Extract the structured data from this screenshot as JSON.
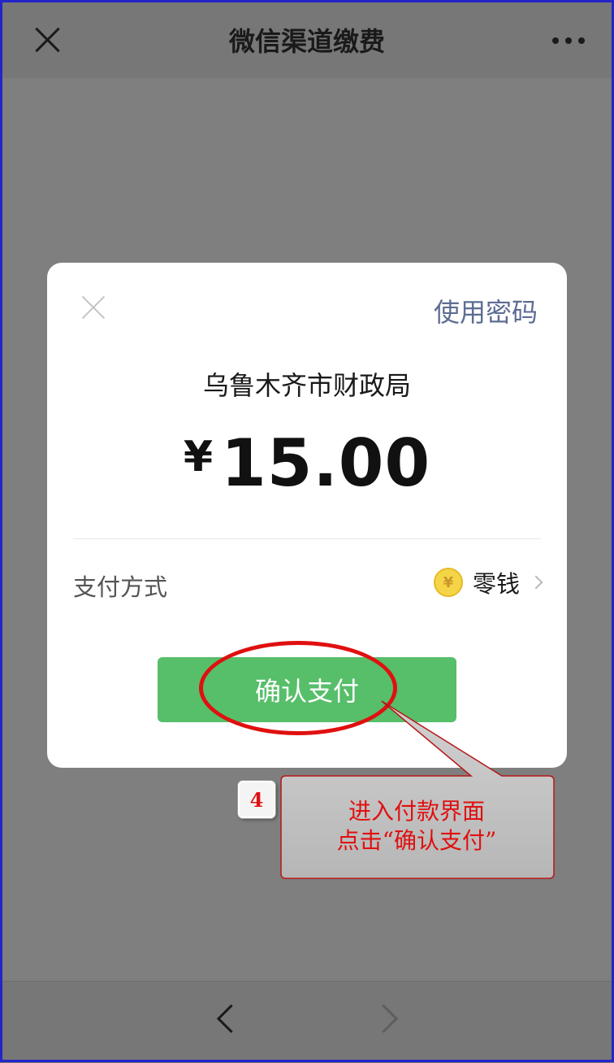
{
  "header": {
    "title": "微信渠道缴费",
    "close_icon": "close-icon",
    "more_icon": "more-icon"
  },
  "dialog": {
    "use_password_label": "使用密码",
    "payee": "乌鲁木齐市财政局",
    "currency_symbol": "¥",
    "amount": "15.00",
    "payment_method_label": "支付方式",
    "payment_method_value": "零钱",
    "coin_glyph": "¥",
    "confirm_label": "确认支付"
  },
  "annotation": {
    "step_number": "4",
    "line1": "进入付款界面",
    "line2": "点击“确认支付”",
    "highlight_color": "#e01010"
  },
  "colors": {
    "confirm_button": "#57be6a",
    "link_text": "#5d6c92",
    "overlay": "#7f7f7f"
  }
}
